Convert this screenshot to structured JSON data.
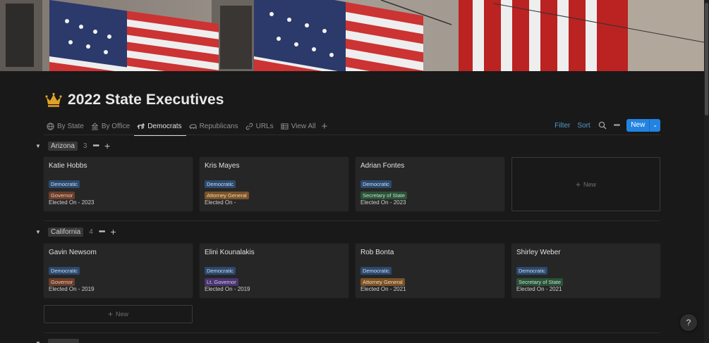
{
  "page": {
    "title": "2022 State Executives",
    "icon": "crown-icon"
  },
  "tabs": [
    {
      "label": "By State",
      "icon": "globe-icon"
    },
    {
      "label": "By Office",
      "icon": "building-icon"
    },
    {
      "label": "Democrats",
      "icon": "donkey-icon",
      "active": true
    },
    {
      "label": "Republicans",
      "icon": "elephant-icon"
    },
    {
      "label": "URLs",
      "icon": "link-icon"
    },
    {
      "label": "View All",
      "icon": "table-icon"
    }
  ],
  "toolbar": {
    "filter": "Filter",
    "sort": "Sort",
    "new": "New"
  },
  "groups": [
    {
      "name": "Arizona",
      "count": "3",
      "cards": [
        {
          "name": "Katie Hobbs",
          "party": "Democratic",
          "office": "Governor",
          "office_color": "brown",
          "elected": "Elected On - 2023"
        },
        {
          "name": "Kris Mayes",
          "party": "Democratic",
          "office": "Attorney General",
          "office_color": "orange",
          "elected": "Elected On -"
        },
        {
          "name": "Adrian Fontes",
          "party": "Democratic",
          "office": "Secretary of State",
          "office_color": "green",
          "elected": "Elected On - 2023"
        }
      ],
      "new_label": "New"
    },
    {
      "name": "California",
      "count": "4",
      "cards": [
        {
          "name": "Gavin Newsom",
          "party": "Democratic",
          "office": "Governor",
          "office_color": "brown",
          "elected": "Elected On - 2019"
        },
        {
          "name": "Elini Kounalakis",
          "party": "Democratic",
          "office": "Lt. Governor",
          "office_color": "purple",
          "elected": "Elected On - 2019"
        },
        {
          "name": "Rob Bonta",
          "party": "Democratic",
          "office": "Attorney General",
          "office_color": "orange",
          "elected": "Elected On - 2021"
        },
        {
          "name": "Shirley Weber",
          "party": "Democratic",
          "office": "Secretary of State",
          "office_color": "green",
          "elected": "Elected On - 2021"
        }
      ],
      "new_label": "New"
    }
  ],
  "help_label": "?",
  "colors": {
    "accent": "#2383e2",
    "link": "#529cca",
    "background": "#191919",
    "card": "#262626"
  }
}
